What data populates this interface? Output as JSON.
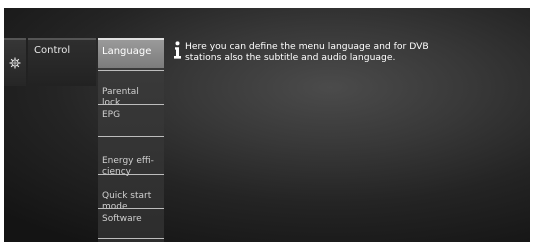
{
  "main_menu": {
    "settings_icon": "gear-icon",
    "label": "Control"
  },
  "submenu": {
    "items": [
      {
        "label": "Language"
      },
      {
        "label": "Parental\nlock"
      },
      {
        "label": "EPG"
      },
      {
        "label": "Energy effi-\nciency"
      },
      {
        "label": "Quick start\nmode"
      },
      {
        "label": "Software"
      }
    ]
  },
  "info": {
    "icon": "info-icon",
    "text": "Here you can define the menu language and for DVB\nstations also the subtitle and audio language."
  },
  "colors": {
    "background_dark": "#1a1a1a",
    "selected_item": "#8e8e8e",
    "text": "#ffffff"
  }
}
